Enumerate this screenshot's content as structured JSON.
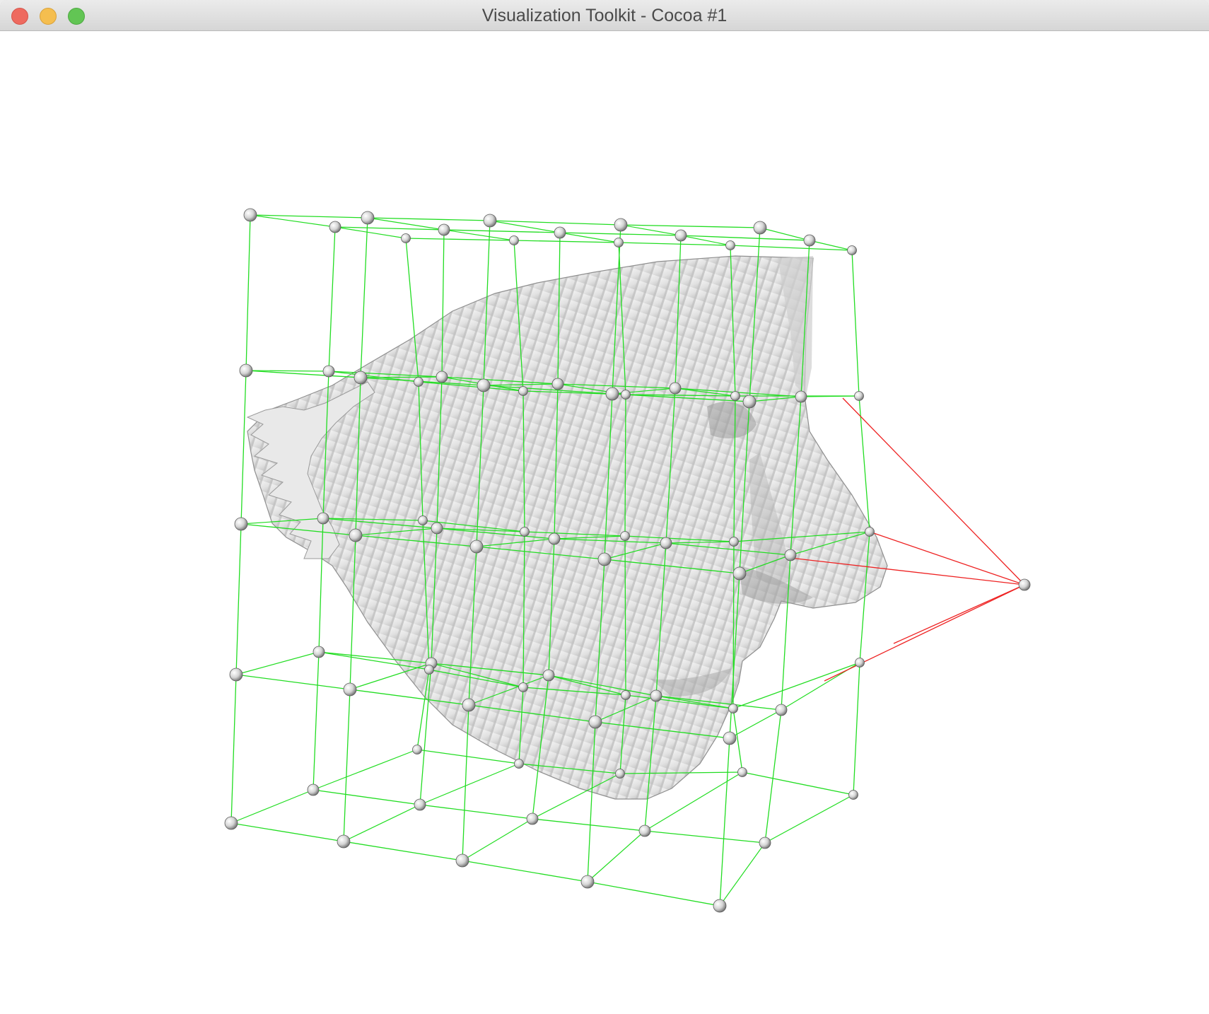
{
  "window": {
    "title": "Visualization Toolkit - Cocoa #1",
    "controls": [
      "close",
      "minimize",
      "zoom"
    ]
  },
  "scene": {
    "description_icons": [
      "face-surface",
      "control-lattice",
      "lattice-handle"
    ],
    "colors": {
      "background": "#ffffff",
      "lattice_lines": "#22dd22",
      "highlight_lines": "#ee2222",
      "handle_fill": "#d8d8d8",
      "surface": "#e6e6e6"
    }
  }
}
